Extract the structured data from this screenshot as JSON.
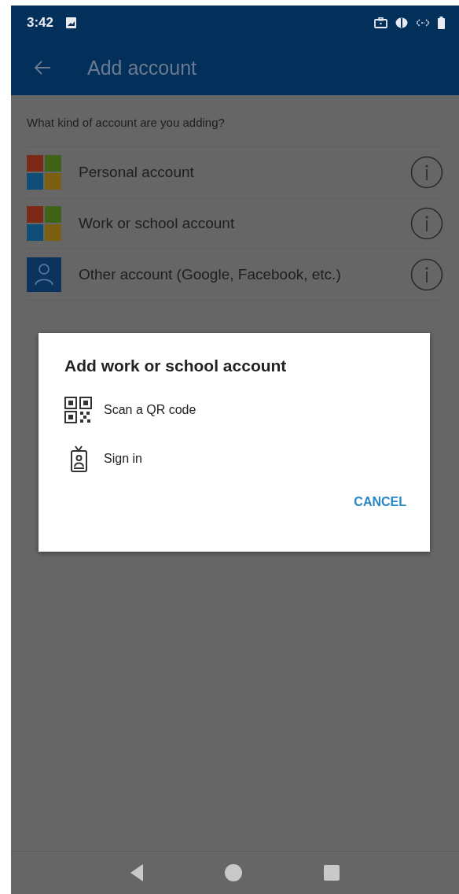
{
  "status_bar": {
    "time": "3:42"
  },
  "app_bar": {
    "title": "Add account"
  },
  "prompt": "What kind of account are you adding?",
  "accounts": [
    {
      "kind": "microsoft",
      "label": "Personal account"
    },
    {
      "kind": "microsoft",
      "label": "Work or school account"
    },
    {
      "kind": "person",
      "label": "Other account (Google, Facebook, etc.)"
    }
  ],
  "dialog": {
    "title": "Add work or school account",
    "options": [
      {
        "kind": "qr",
        "label": "Scan a QR code"
      },
      {
        "kind": "badge",
        "label": "Sign in"
      }
    ],
    "buttons": [
      "CANCEL"
    ]
  }
}
